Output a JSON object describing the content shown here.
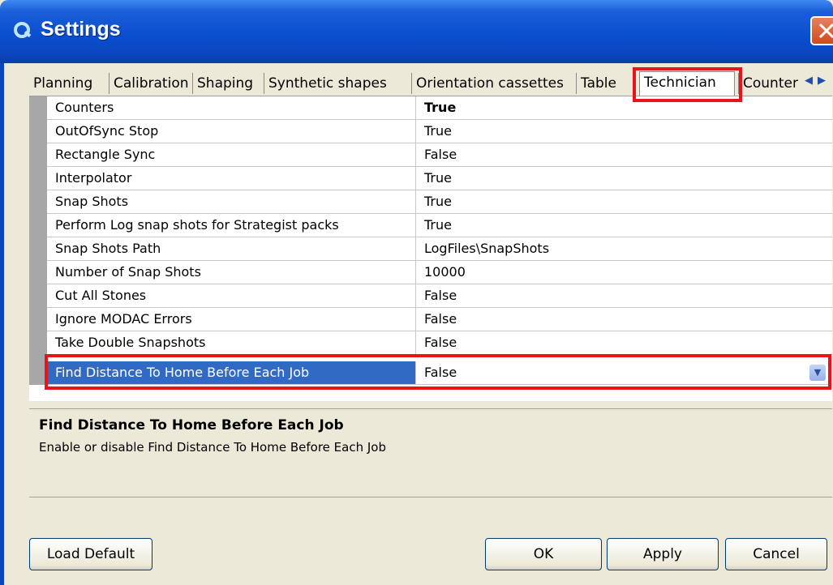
{
  "window": {
    "title": "Settings"
  },
  "tabs": [
    {
      "label": "Planning"
    },
    {
      "label": "Calibration"
    },
    {
      "label": "Shaping"
    },
    {
      "label": "Synthetic shapes"
    },
    {
      "label": "Orientation cassettes"
    },
    {
      "label": "Table"
    },
    {
      "label": "Technician"
    },
    {
      "label": "Counters"
    }
  ],
  "active_tab": "Technician",
  "properties": [
    {
      "name": "Counters",
      "value": "True"
    },
    {
      "name": "OutOfSync Stop",
      "value": "True"
    },
    {
      "name": "Rectangle Sync",
      "value": "False"
    },
    {
      "name": "Interpolator",
      "value": "True"
    },
    {
      "name": "Snap Shots",
      "value": "True"
    },
    {
      "name": "Perform Log snap shots for Strategist packs",
      "value": "True"
    },
    {
      "name": "Snap Shots Path",
      "value": "LogFiles\\SnapShots"
    },
    {
      "name": "Number of Snap Shots",
      "value": "10000"
    },
    {
      "name": "Cut All Stones",
      "value": "False"
    },
    {
      "name": "Ignore MODAC Errors",
      "value": "False"
    },
    {
      "name": "Take Double Snapshots",
      "value": "False"
    },
    {
      "name": "Find Distance To Home Before Each Job",
      "value": "False"
    }
  ],
  "description": {
    "title": "Find Distance To Home Before Each Job",
    "text": "Enable or disable Find Distance To Home Before Each Job"
  },
  "buttons": {
    "load_default": "Load Default",
    "ok": "OK",
    "apply": "Apply",
    "cancel": "Cancel"
  },
  "colors": {
    "highlight": "#e8141b",
    "selection": "#316ac5",
    "title_bar": "#0a4fd0"
  },
  "icons": {
    "app": "app-logo-icon",
    "close": "close-icon",
    "tab_scroll_left": "chevron-left-icon",
    "tab_scroll_right": "chevron-right-icon",
    "dropdown": "chevron-down-icon"
  }
}
